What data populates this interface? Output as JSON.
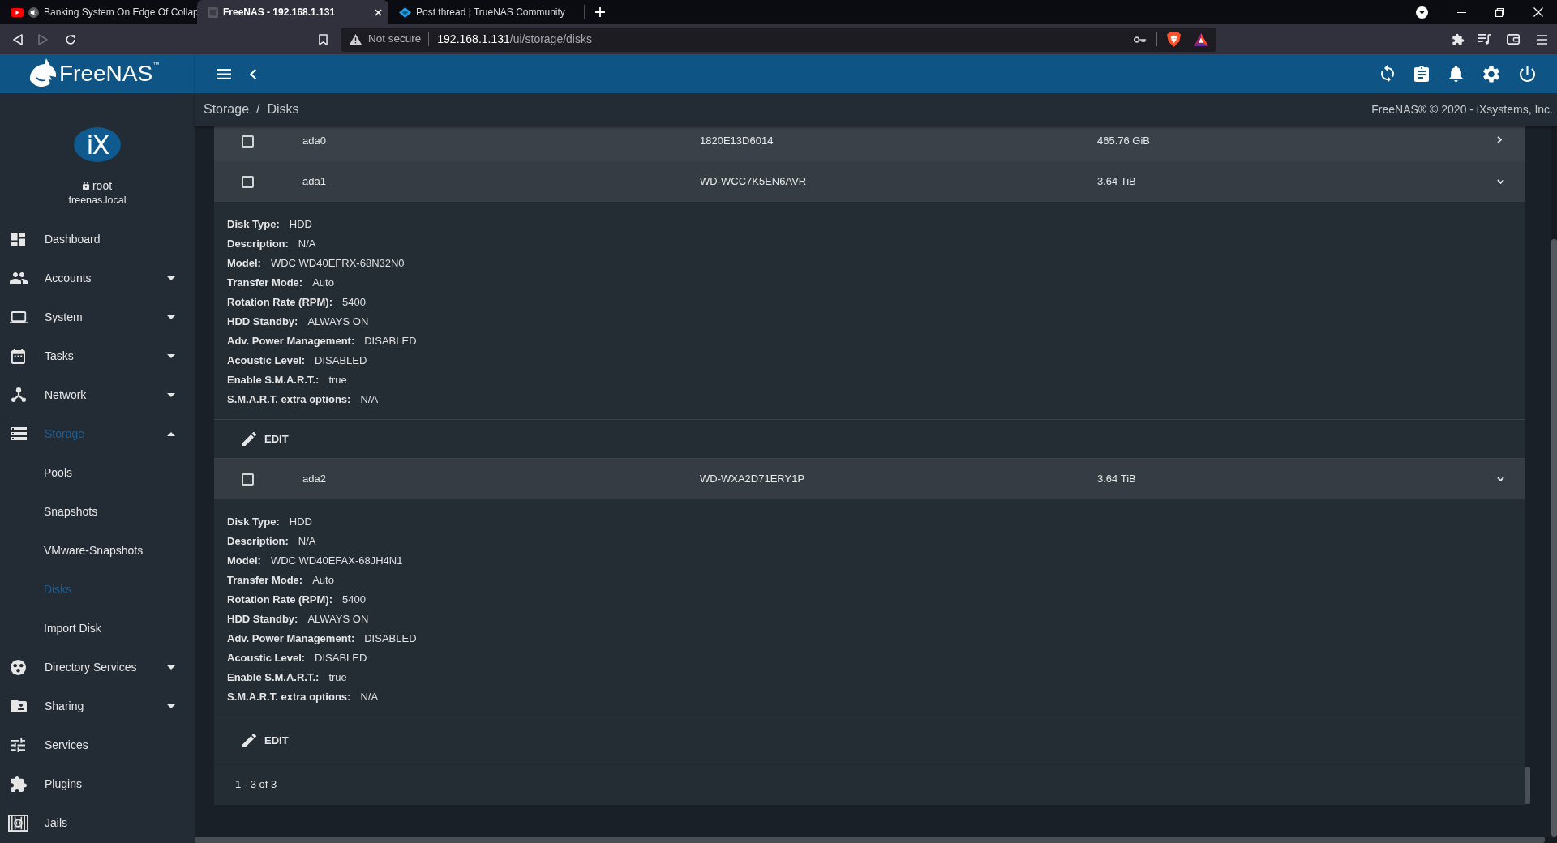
{
  "browser": {
    "tabs": [
      {
        "title": "Banking System On Edge Of Collap",
        "kind": "video",
        "playing_audio": true,
        "selected": false
      },
      {
        "title": "FreeNAS - 192.168.1.131",
        "kind": "site",
        "playing_audio": false,
        "selected": true
      },
      {
        "title": "Post thread | TrueNAS Community",
        "kind": "forum",
        "playing_audio": false,
        "selected": false
      }
    ],
    "address_bar": {
      "security": "Not secure",
      "host": "192.168.1.131",
      "path": "/ui/storage/disks"
    },
    "forward_enabled": false
  },
  "header": {
    "logo": "FreeNAS$^{™}$"
  },
  "sidebar": {
    "badge": "iX",
    "user": "root",
    "host": "freenas.local",
    "items": [
      {
        "label": "Dashboard",
        "selected": false
      },
      {
        "label": "Accounts",
        "selected": false,
        "expanded": false
      },
      {
        "label": "System",
        "selected": false,
        "expanded": false
      },
      {
        "label": "Tasks",
        "selected": false,
        "expanded": false
      },
      {
        "label": "Network",
        "selected": false,
        "expanded": false
      },
      {
        "label": "Storage",
        "selected": true,
        "expanded": true,
        "children": [
          {
            "label": "Pools",
            "selected": false
          },
          {
            "label": "Snapshots",
            "selected": false
          },
          {
            "label": "VMware-Snapshots",
            "selected": false
          },
          {
            "label": "Disks",
            "selected": true
          },
          {
            "label": "Import Disk",
            "selected": false
          }
        ]
      },
      {
        "label": "Directory Services",
        "selected": false,
        "expanded": false
      },
      {
        "label": "Sharing",
        "selected": false,
        "expanded": false
      },
      {
        "label": "Services",
        "selected": false
      },
      {
        "label": "Plugins",
        "selected": false
      },
      {
        "label": "Jails",
        "selected": false
      }
    ]
  },
  "breadcrumb": {
    "items": [
      "Storage",
      "Disks"
    ],
    "separator": "/"
  },
  "copyright": "FreeNAS® © 2020 - iXsystems, Inc.",
  "disks": {
    "rows": [
      {
        "cells": [
          "ada0",
          "1820E13D6014",
          "465.76 GiB"
        ],
        "checked": false,
        "expanded": false
      },
      {
        "cells": [
          "ada1",
          "WD-WCC7K5EN6AVR",
          "3.64 TiB"
        ],
        "checked": false,
        "expanded": true,
        "details": [
          {
            "label": "Disk Type:",
            "value": "HDD"
          },
          {
            "label": "Description:",
            "value": "N/A"
          },
          {
            "label": "Model:",
            "value": "WDC WD40EFRX-68N32N0"
          },
          {
            "label": "Transfer Mode:",
            "value": "Auto"
          },
          {
            "label": "Rotation Rate (RPM):",
            "value": "5400"
          },
          {
            "label": "HDD Standby:",
            "value": "ALWAYS ON"
          },
          {
            "label": "Adv. Power Management:",
            "value": "DISABLED"
          },
          {
            "label": "Acoustic Level:",
            "value": "DISABLED"
          },
          {
            "label": "Enable S.M.A.R.T.:",
            "value": "true"
          },
          {
            "label": "S.M.A.R.T. extra options:",
            "value": "N/A"
          }
        ],
        "action": "EDIT"
      },
      {
        "cells": [
          "ada2",
          "WD-WXA2D71ERY1P",
          "3.64 TiB"
        ],
        "checked": false,
        "expanded": true,
        "details": [
          {
            "label": "Disk Type:",
            "value": "HDD"
          },
          {
            "label": "Description:",
            "value": "N/A"
          },
          {
            "label": "Model:",
            "value": "WDC WD40EFAX-68JH4N1"
          },
          {
            "label": "Transfer Mode:",
            "value": "Auto"
          },
          {
            "label": "Rotation Rate (RPM):",
            "value": "5400"
          },
          {
            "label": "HDD Standby:",
            "value": "ALWAYS ON"
          },
          {
            "label": "Adv. Power Management:",
            "value": "DISABLED"
          },
          {
            "label": "Acoustic Level:",
            "value": "DISABLED"
          },
          {
            "label": "Enable S.M.A.R.T.:",
            "value": "true"
          },
          {
            "label": "S.M.A.R.T. extra options:",
            "value": "N/A"
          }
        ],
        "action": "EDIT"
      }
    ],
    "pagination": "1 - 3 of 3"
  }
}
